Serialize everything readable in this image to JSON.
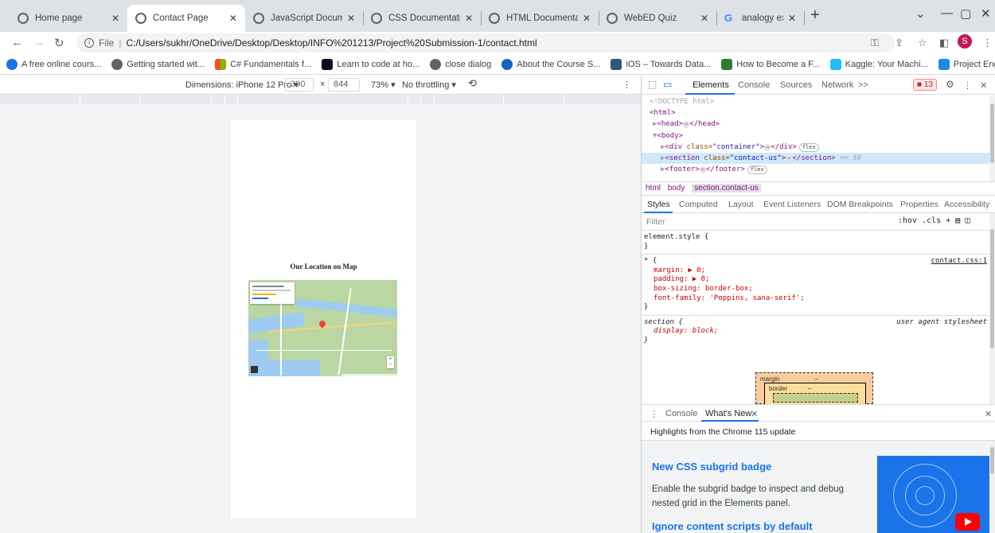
{
  "tabs": [
    {
      "label": "Home page",
      "icon": "globe-icon"
    },
    {
      "label": "Contact Page",
      "icon": "globe-icon"
    },
    {
      "label": "JavaScript Document",
      "icon": "globe-icon"
    },
    {
      "label": "CSS Documentation",
      "icon": "globe-icon"
    },
    {
      "label": "HTML Documentation",
      "icon": "globe-icon"
    },
    {
      "label": "WebED Quiz",
      "icon": "globe-icon"
    },
    {
      "label": "analogy examples - G",
      "icon": "google-icon"
    }
  ],
  "address": {
    "scheme_label": "File",
    "url": "C:/Users/sukhr/OneDrive/Desktop/Desktop/INFO%201213/Project%20Submission-1/contact.html"
  },
  "profile_initial": "S",
  "bookmarks": [
    {
      "label": "A free online cours...",
      "color": "#1a73e8"
    },
    {
      "label": "Getting started wit...",
      "color": "#5f6368"
    },
    {
      "label": "C# Fundamentals f...",
      "color": "#f25022"
    },
    {
      "label": "Learn to code at ho...",
      "color": "#0a0a23"
    },
    {
      "label": "close dialog",
      "color": "#5f6368"
    },
    {
      "label": "About the Course S...",
      "color": "#1565c0"
    },
    {
      "label": "iOS – Towards Data...",
      "color": "#355876"
    },
    {
      "label": "How to Become a F...",
      "color": "#2e7d32"
    },
    {
      "label": "Kaggle: Your Machi...",
      "color": "#20beff"
    },
    {
      "label": "Project English Clas...",
      "color": "#1e88e5"
    }
  ],
  "device_toolbar": {
    "dimensions_label": "Dimensions: iPhone 12 Pro",
    "width": "390",
    "height": "844",
    "zoom": "73%",
    "throttling": "No throttling"
  },
  "page": {
    "map_heading": "Our Location on Map"
  },
  "devtools": {
    "tabs": [
      "Elements",
      "Console",
      "Sources",
      "Network",
      ">>"
    ],
    "issues_count": "13",
    "dom_lines": {
      "doctype": "<!DOCTYPE html>",
      "html_open": "<html>",
      "head": "<head>",
      "head_close": "</head>",
      "body": "<body>",
      "div_tag": "<div",
      "div_attr": "class=",
      "div_val": "\"container\"",
      "div_close": "</div>",
      "section_tag": "<section",
      "section_attr": "class=",
      "section_val": "\"contact-us\"",
      "section_close": "</section>",
      "section_suffix": "== $0",
      "footer_open": "<footer>",
      "footer_close": "</footer>",
      "badge": "flex"
    },
    "breadcrumbs": [
      "html",
      "body",
      "section.contact-us"
    ],
    "styles_tabs": [
      "Styles",
      "Computed",
      "Layout",
      "Event Listeners",
      "DOM Breakpoints",
      "Properties",
      "Accessibility"
    ],
    "filter_placeholder": "Filter",
    "filter_tools": ":hov .cls",
    "rules": {
      "element_style": "element.style {",
      "close": "}",
      "universal": "* {",
      "source1": "contact.css:1",
      "margin": "margin: ▶ 0;",
      "padding": "padding: ▶ 0;",
      "box_sizing": "box-sizing: border-box;",
      "font_family": "font-family: 'Poppins, sana-serif';",
      "section_sel": "section {",
      "source2": "user agent stylesheet",
      "display": "display: block;"
    },
    "box_model": {
      "margin": "margin",
      "border": "border",
      "dash": "–"
    },
    "drawer_tabs": [
      "Console",
      "What's New"
    ],
    "whats_new": {
      "highlights": "Highlights from the Chrome 115 update",
      "title1": "New CSS subgrid badge",
      "desc1": "Enable the subgrid badge to inspect and debug nested grid in the Elements panel.",
      "title2": "Ignore content scripts by default"
    }
  }
}
